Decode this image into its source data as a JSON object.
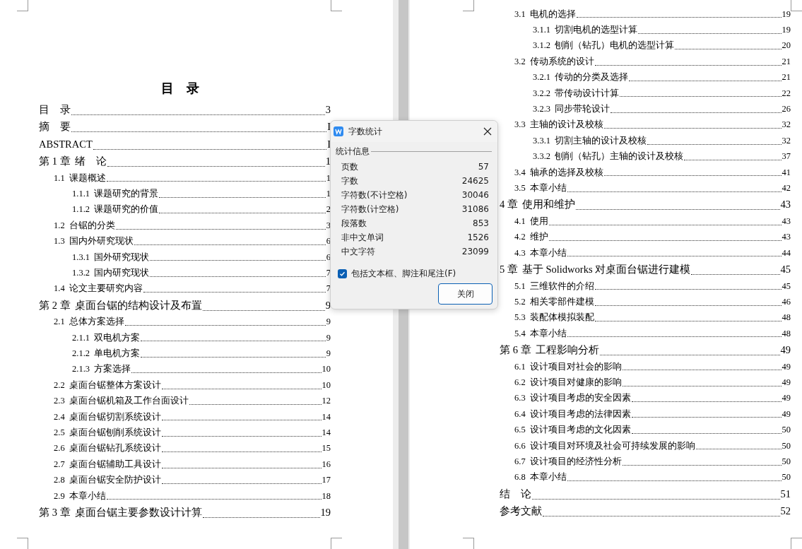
{
  "left_page": {
    "title": "目　录",
    "entries": [
      {
        "title": "目　录",
        "page": "3"
      },
      {
        "title": "摘　要",
        "page": "I"
      },
      {
        "title": "ABSTRACT",
        "page": "I"
      },
      {
        "number": "第 1 章",
        "title": "绪　论",
        "page": "1",
        "children": [
          {
            "number": "1.1",
            "title": "课题概述",
            "page": "1",
            "children": [
              {
                "number": "1.1.1",
                "title": "课题研究的背景",
                "page": "1"
              },
              {
                "number": "1.1.2",
                "title": "课题研究的价值",
                "page": "2"
              }
            ]
          },
          {
            "number": "1.2",
            "title": "台锯的分类",
            "page": "3"
          },
          {
            "number": "1.3",
            "title": "国内外研究现状",
            "page": "6",
            "children": [
              {
                "number": "1.3.1",
                "title": "国外研究现状",
                "page": "6"
              },
              {
                "number": "1.3.2",
                "title": "国内研究现状",
                "page": "7"
              }
            ]
          },
          {
            "number": "1.4",
            "title": "论文主要研究内容",
            "page": "7"
          }
        ]
      },
      {
        "number": "第 2 章",
        "title": "桌面台锯的结构设计及布置",
        "page": "9",
        "children": [
          {
            "number": "2.1",
            "title": "总体方案选择",
            "page": "9",
            "children": [
              {
                "number": "2.1.1",
                "title": "双电机方案",
                "page": "9"
              },
              {
                "number": "2.1.2",
                "title": "单电机方案",
                "page": "9"
              },
              {
                "number": "2.1.3",
                "title": "方案选择",
                "page": "10"
              }
            ]
          },
          {
            "number": "2.2",
            "title": "桌面台锯整体方案设计",
            "page": "10"
          },
          {
            "number": "2.3",
            "title": "桌面台锯机箱及工作台面设计",
            "page": "12"
          },
          {
            "number": "2.4",
            "title": "桌面台锯切割系统设计",
            "page": "14"
          },
          {
            "number": "2.5",
            "title": "桌面台锯刨削系统设计",
            "page": "14"
          },
          {
            "number": "2.6",
            "title": "桌面台锯钻孔系统设计",
            "page": "15"
          },
          {
            "number": "2.7",
            "title": "桌面台锯辅助工具设计",
            "page": "16"
          },
          {
            "number": "2.8",
            "title": "桌面台锯安全防护设计",
            "page": "17"
          },
          {
            "number": "2.9",
            "title": "本章小结",
            "page": "18"
          }
        ]
      },
      {
        "number": "第 3 章",
        "title": "桌面台锯主要参数设计计算",
        "page": "19"
      }
    ]
  },
  "right_page": {
    "continued_sections": [
      {
        "number": "3.1",
        "title": "电机的选择",
        "page": "19",
        "children": [
          {
            "number": "3.1.1",
            "title": "切割电机的选型计算",
            "page": "19"
          },
          {
            "number": "3.1.2",
            "title": "刨削（钻孔）电机的选型计算",
            "page": "20"
          }
        ]
      },
      {
        "number": "3.2",
        "title": "传动系统的设计",
        "page": "21",
        "children": [
          {
            "number": "3.2.1",
            "title": "传动的分类及选择",
            "page": "21"
          },
          {
            "number": "3.2.2",
            "title": "带传动设计计算",
            "page": "22"
          },
          {
            "number": "3.2.3",
            "title": "同步带轮设计",
            "page": "26"
          }
        ]
      },
      {
        "number": "3.3",
        "title": "主轴的设计及校核",
        "page": "32",
        "children": [
          {
            "number": "3.3.1",
            "title": "切割主轴的设计及校核",
            "page": "32"
          },
          {
            "number": "3.3.2",
            "title": "刨削（钻孔）主轴的设计及校核",
            "page": "37"
          }
        ]
      },
      {
        "number": "3.4",
        "title": "轴承的选择及校核",
        "page": "41"
      },
      {
        "number": "3.5",
        "title": "本章小结",
        "page": "42"
      }
    ],
    "entries": [
      {
        "number": "4 章",
        "title": "使用和维护",
        "page": "43",
        "children": [
          {
            "number": "4.1",
            "title": "使用",
            "page": "43"
          },
          {
            "number": "4.2",
            "title": "维护",
            "page": "43"
          },
          {
            "number": "4.3",
            "title": "本章小结",
            "page": "44"
          }
        ]
      },
      {
        "number": "5 章",
        "title": "基于 Solidworks 对桌面台锯进行建模",
        "page": "45",
        "children": [
          {
            "number": "5.1",
            "title": "三维软件的介绍",
            "page": "45"
          },
          {
            "number": "5.2",
            "title": "相关零部件建模",
            "page": "46"
          },
          {
            "number": "5.3",
            "title": "装配体模拟装配",
            "page": "48"
          },
          {
            "number": "5.4",
            "title": "本章小结",
            "page": "48"
          }
        ]
      },
      {
        "number": "第 6 章",
        "title": "工程影响分析",
        "page": "49",
        "children": [
          {
            "number": "6.1",
            "title": "设计项目对社会的影响",
            "page": "49"
          },
          {
            "number": "6.2",
            "title": "设计项目对健康的影响",
            "page": "49"
          },
          {
            "number": "6.3",
            "title": "设计项目考虑的安全因素",
            "page": "49"
          },
          {
            "number": "6.4",
            "title": "设计项目考虑的法律因素",
            "page": "49"
          },
          {
            "number": "6.5",
            "title": "设计项目考虑的文化因素",
            "page": "50"
          },
          {
            "number": "6.6",
            "title": "设计项目对环境及社会可持续发展的影响",
            "page": "50"
          },
          {
            "number": "6.7",
            "title": "设计项目的经济性分析",
            "page": "50"
          },
          {
            "number": "6.8",
            "title": "本章小结",
            "page": "50"
          }
        ]
      },
      {
        "title": "结　论",
        "page": "51"
      },
      {
        "title": "参考文献",
        "page": "52"
      }
    ]
  },
  "dialog": {
    "title": "字数统计",
    "group": "统计信息",
    "stats": [
      {
        "label": "页数",
        "value": "57"
      },
      {
        "label": "字数",
        "value": "24625"
      },
      {
        "label": "字符数(不计空格)",
        "value": "30046"
      },
      {
        "label": "字符数(计空格)",
        "value": "31086"
      },
      {
        "label": "段落数",
        "value": "853"
      },
      {
        "label": "非中文单词",
        "value": "1526"
      },
      {
        "label": "中文字符",
        "value": "23099"
      }
    ],
    "include_option": {
      "label": "包括文本框、脚注和尾注(F)",
      "checked": true
    },
    "close_button": "关闭"
  }
}
